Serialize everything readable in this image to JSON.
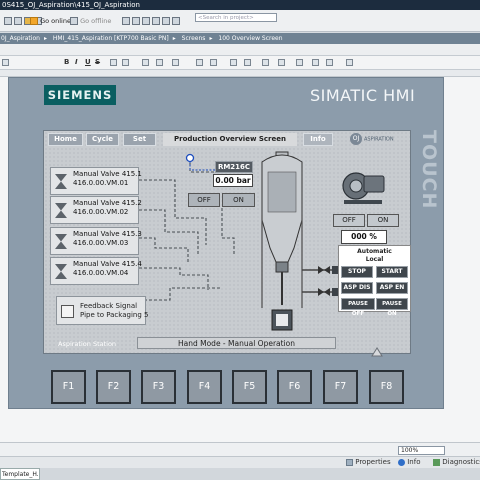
{
  "window": {
    "title": "0S415_OJ_Aspiration\\415_OJ_Aspiration"
  },
  "toolbar": {
    "go_online": "Go online",
    "go_offline": "Go offline",
    "search_placeholder": "<Search in project>"
  },
  "breadcrumb": [
    "0J_Aspiration",
    "HMI_415_Aspiration [KTP700 Basic PN]",
    "Screens",
    "100 Overview Screen"
  ],
  "format_toolbar": {
    "bold": "B",
    "italic": "I",
    "underline": "U",
    "strike": "S"
  },
  "device": {
    "brand": "SIEMENS",
    "model": "SIMATIC HMI",
    "touch_label": "TOUCH"
  },
  "hmi": {
    "nav": {
      "home": "Home",
      "cycle": "Cycle",
      "set": "Set",
      "info": "Info"
    },
    "screen_title": "Production Overview Screen",
    "oj_logo_text": "ASPIRATION",
    "valves": [
      {
        "line1": "Manual Valve 415.1",
        "line2": "416.0.00.VM.01"
      },
      {
        "line1": "Manual Valve 415.2",
        "line2": "416.0.00.VM.02"
      },
      {
        "line1": "Manual Valve 415.3",
        "line2": "416.0.00.VM.03"
      },
      {
        "line1": "Manual Valve 415.4",
        "line2": "416.0.00.VM.04"
      }
    ],
    "feedback": {
      "line1": "Feedback Signal",
      "line2": "Pipe to Packaging 5"
    },
    "rm_tag": "RM216C",
    "pressure_value": "0.00 bar",
    "pressure_off": "OFF",
    "pressure_on": "ON",
    "fan_off": "OFF",
    "fan_on": "ON",
    "fan_speed": "000 %",
    "auto_title_1": "Automatic",
    "auto_title_2": "Local",
    "buttons": {
      "stop": "STOP",
      "start": "START",
      "asp_dis": "ASP DIS",
      "asp_en": "ASP EN",
      "pause_off": "PAUSE OFF",
      "pause_on": "PAUSE ON"
    },
    "aspiration_station": "Aspiration Station",
    "mode": "Hand Mode - Manual Operation"
  },
  "function_keys": [
    "F1",
    "F2",
    "F3",
    "F4",
    "F5",
    "F6",
    "F7",
    "F8"
  ],
  "zoom": "100%",
  "bottom_tabs": {
    "properties": "Properties",
    "info": "Info",
    "diagnostics": "Diagnostics"
  },
  "taskbar": {
    "tab": "Template_H..."
  },
  "colors": {
    "siemens_teal": "#0a5e61",
    "panel_gray": "#8c9cab",
    "breadcrumb": "#6f8293"
  }
}
